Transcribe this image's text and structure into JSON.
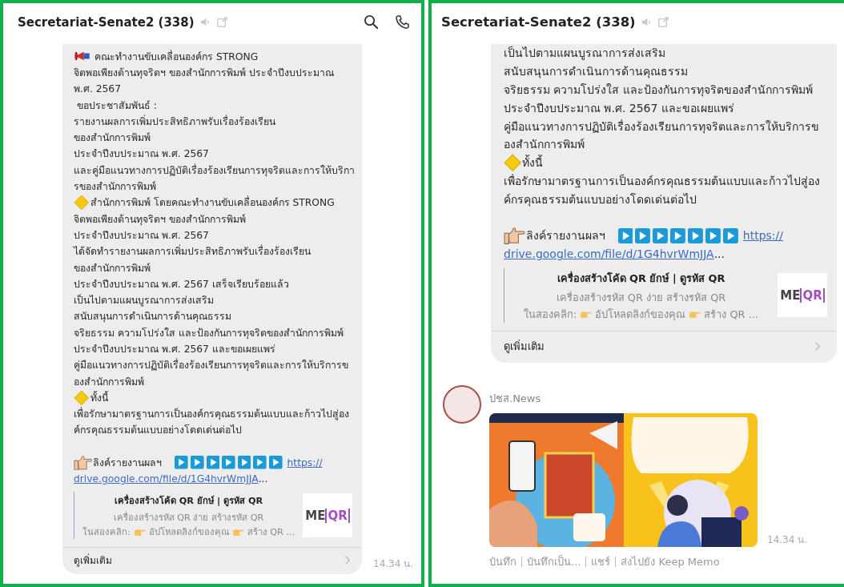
{
  "panels": [
    {
      "title": "Secretariat-Senate2 (338)",
      "header_actions": [
        {
          "kind": "search"
        },
        {
          "kind": "call"
        }
      ],
      "messages": [
        {
          "kind": "post",
          "lines": [
            {
              "kind": "announcement",
              "text": "คณะทำงานขับเคลื่อนองค์กร STRONG"
            },
            {
              "kind": "text",
              "text": "จิตพอเพียงต้านทุจริตฯ ของสำนักการพิมพ์ ประจำปีงบประมาณ"
            },
            {
              "kind": "text",
              "text": "พ.ศ. 2567"
            },
            {
              "kind": "text",
              "text": " ขอประชาสัมพันธ์ :"
            },
            {
              "kind": "text",
              "text": "รายงานผลการเพิ่มประสิทธิภาพรับเรื่องร้องเรียน"
            },
            {
              "kind": "text",
              "text": "ของสำนักการพิมพ์"
            },
            {
              "kind": "text",
              "text": "ประจำปีงบประมาณ พ.ศ. 2567"
            },
            {
              "kind": "text",
              "text": "และคู่มือแนวทางการปฏิบัติเรื่องร้องเรียนการทุจริตและการให้บริกา"
            },
            {
              "kind": "text",
              "text": "รของสำนักการพิมพ์"
            },
            {
              "kind": "bullet",
              "text": "สำนักการพิมพ์ โดยคณะทำงานขับเคลื่อนองค์กร STRONG"
            },
            {
              "kind": "text",
              "text": "จิตพอเพียงต้านทุจริตฯ ของสำนักการพิมพ์"
            },
            {
              "kind": "text",
              "text": "ประจำปีงบประมาณ พ.ศ. 2567"
            },
            {
              "kind": "text",
              "text": "ได้จัดทำรายงานผลการเพิ่มประสิทธิภาพรับเรื่องร้องเรียน"
            },
            {
              "kind": "text",
              "text": "ของสำนักการพิมพ์"
            },
            {
              "kind": "text",
              "text": "ประจำปีงบประมาณ พ.ศ. 2567 เสร็จเรียบร้อยแล้ว"
            },
            {
              "kind": "text",
              "text": "เป็นไปตามแผนบูรณาการส่งเสริม"
            },
            {
              "kind": "text",
              "text": "สนับสนุนการดำเนินการด้านคุณธรรม"
            },
            {
              "kind": "text",
              "text": "จริยธรรม ความโปร่งใส และป้องกันการทุจริตของสำนักการพิมพ์"
            },
            {
              "kind": "text",
              "text": "ประจำปีงบประมาณ พ.ศ. 2567 และขอเผยแพร่"
            },
            {
              "kind": "text",
              "text": "คู่มือแนวทางการปฏิบัติเรื่องร้องเรียนการทุจริตและการให้บริการข"
            },
            {
              "kind": "text",
              "text": "องสำนักการพิมพ์"
            },
            {
              "kind": "bullet",
              "text": "ทั้งนี้"
            },
            {
              "kind": "text",
              "text": "เพื่อรักษามาตรฐานการเป็นองค์กรคุณธรรมต้นแบบและก้าวไปสู่อง"
            },
            {
              "kind": "text",
              "text": "ค์กรคุณธรรมต้นแบบอย่างโดดเด่นต่อไป"
            },
            {
              "kind": "gap"
            }
          ],
          "link": {
            "label": "ลิงค์รายงานผลฯ",
            "url_start": "https://",
            "url_rest": "drive.google.com/file/d/1G4hvrWmJJA",
            "ellipsis": "..."
          },
          "preview": {
            "title": "เครื่องสร้างโค้ด QR ยักษ์ | ดูรหัส QR",
            "description": "เครื่องสร้างรหัส QR ง่าย สร้างรหัส QR",
            "description_parts": [
              "ในสองคลิก:",
              "อัปโหลดลิงก์ของคุณ",
              "สร้าง QR ..."
            ],
            "logo": [
              "ME",
              "QR"
            ]
          },
          "more": "ดูเพิ่มเติม",
          "time": "14.34 น."
        }
      ]
    },
    {
      "title": "Secretariat-Senate2 (338)",
      "messages": [
        {
          "kind": "post",
          "lines": [
            {
              "kind": "text",
              "text": "เป็นไปตามแผนบูรณาการส่งเสริม"
            },
            {
              "kind": "text",
              "text": "สนับสนุนการดำเนินการด้านคุณธรรม"
            },
            {
              "kind": "text",
              "text": "จริยธรรม ความโปร่งใส และป้องกันการทุจริตของสำนักการพิมพ์"
            },
            {
              "kind": "text",
              "text": "ประจำปีงบประมาณ พ.ศ. 2567 และขอเผยแพร่"
            },
            {
              "kind": "text",
              "text": "คู่มือแนวทางการปฏิบัติเรื่องร้องเรียนการทุจริตและการให้บริการข"
            },
            {
              "kind": "text",
              "text": "องสำนักการพิมพ์"
            },
            {
              "kind": "bullet",
              "text": "ทั้งนี้"
            },
            {
              "kind": "text",
              "text": "เพื่อรักษามาตรฐานการเป็นองค์กรคุณธรรมต้นแบบและก้าวไปสู่อง"
            },
            {
              "kind": "text",
              "text": "ค์กรคุณธรรมต้นแบบอย่างโดดเด่นต่อไป"
            },
            {
              "kind": "gap"
            }
          ],
          "link": {
            "label": "ลิงค์รายงานผลฯ",
            "url_start": "https://",
            "url_rest": "drive.google.com/file/d/1G4hvrWmJJA",
            "ellipsis": "..."
          },
          "preview": {
            "title": "เครื่องสร้างโค้ด QR ยักษ์ | ดูรหัส QR",
            "description": "เครื่องสร้างรหัส QR ง่าย สร้างรหัส QR",
            "description_parts": [
              "ในสองคลิก:",
              "อัปโหลดลิงก์ของคุณ",
              "สร้าง QR ..."
            ],
            "logo": [
              "ME",
              "QR"
            ]
          },
          "more": "ดูเพิ่มเติม"
        },
        {
          "sender": "ปชส.News",
          "time": "14.34 น.",
          "actions": [
            "บันทึก",
            "บันทึกเป็น...",
            "แชร์",
            "ส่งไปยัง Keep Memo"
          ]
        }
      ]
    }
  ]
}
